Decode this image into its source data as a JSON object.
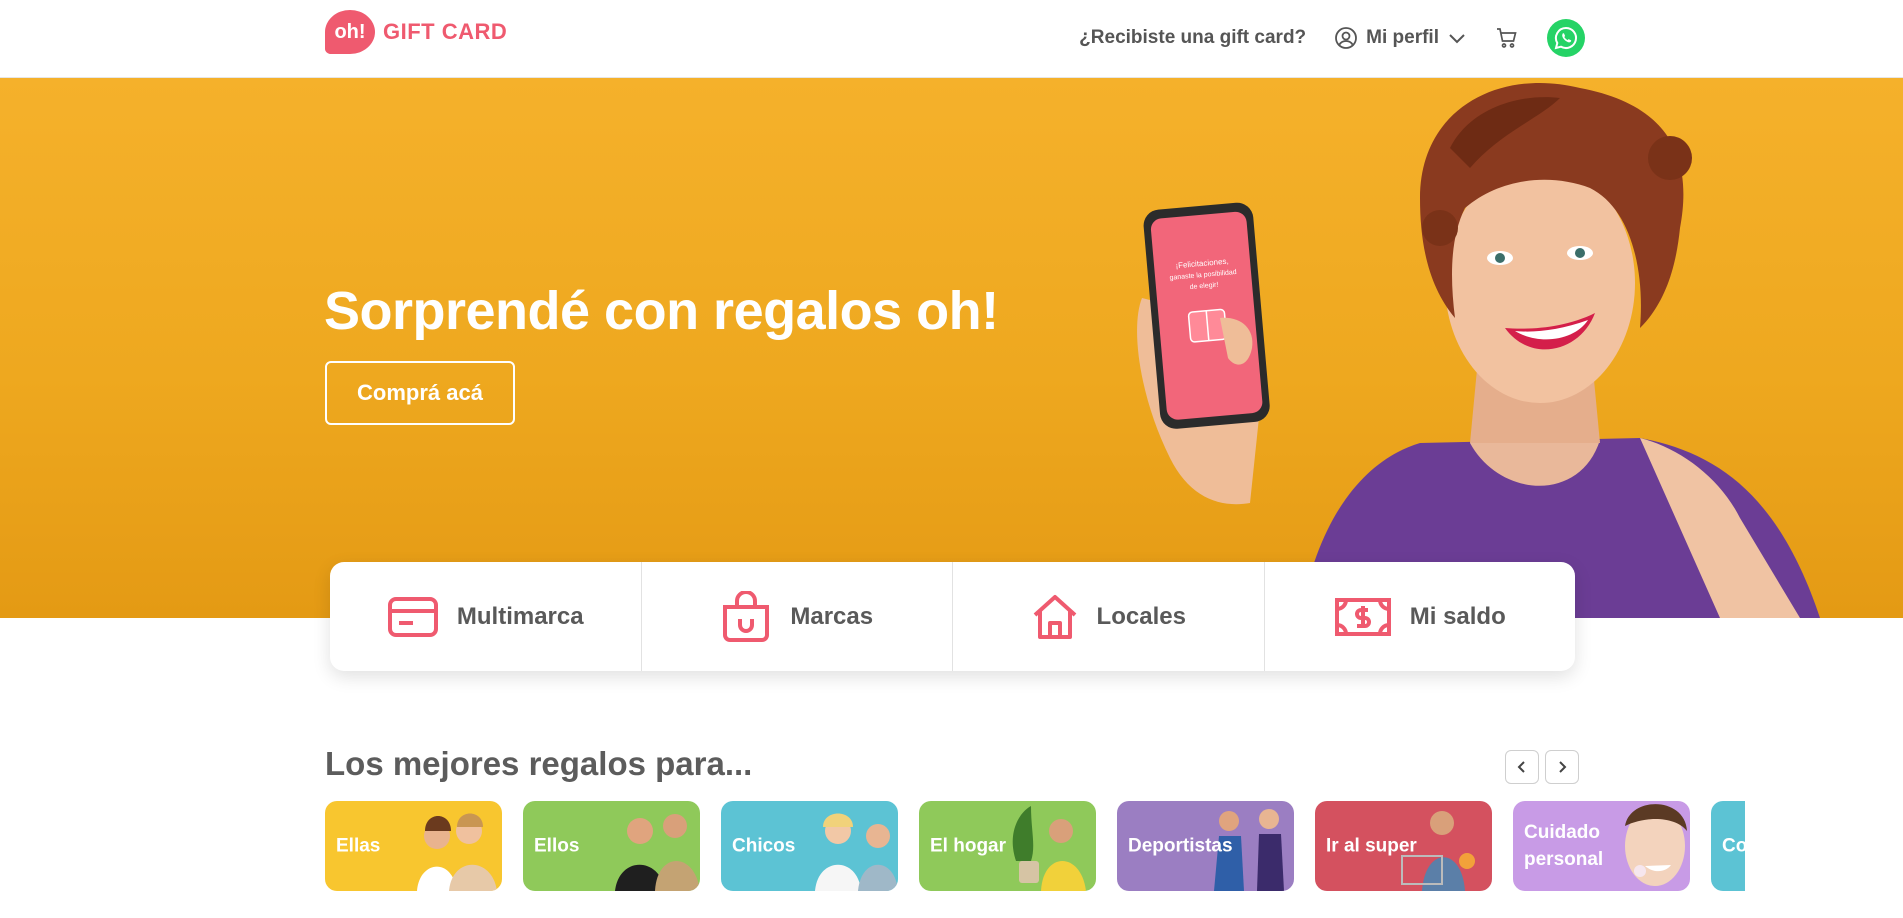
{
  "header": {
    "logo_badge": "oh!",
    "logo_text": "GIFT CARD",
    "nav_received": "¿Recibiste una gift card?",
    "profile_label": "Mi perfil"
  },
  "hero": {
    "title": "Sorprendé con regalos oh!",
    "cta": "Comprá acá",
    "phone_text_1": "¡Felicitaciones,",
    "phone_text_2": "ganaste la posibilidad",
    "phone_text_3": "de elegir!"
  },
  "quick_actions": [
    {
      "label": "Multimarca",
      "icon": "card-icon"
    },
    {
      "label": "Marcas",
      "icon": "shopping-bag-icon"
    },
    {
      "label": "Locales",
      "icon": "house-icon"
    },
    {
      "label": "Mi saldo",
      "icon": "money-icon"
    }
  ],
  "section": {
    "title": "Los mejores regalos para..."
  },
  "categories": [
    {
      "label": "Ellas",
      "color": "#f8c62f"
    },
    {
      "label": "Ellos",
      "color": "#8fc95a"
    },
    {
      "label": "Chicos",
      "color": "#5cc3d4"
    },
    {
      "label": "El hogar",
      "color": "#8fc95a"
    },
    {
      "label": "Deportistas",
      "color": "#9b7ec2"
    },
    {
      "label": "Ir al super",
      "color": "#d4515f"
    },
    {
      "label": "Cuidado personal",
      "color": "#c89be6"
    },
    {
      "label": "Co",
      "color": "#5cc3d4"
    }
  ],
  "colors": {
    "brand": "#ef5a6f",
    "hero_bg": "#f2ac24",
    "whatsapp": "#25d366"
  }
}
